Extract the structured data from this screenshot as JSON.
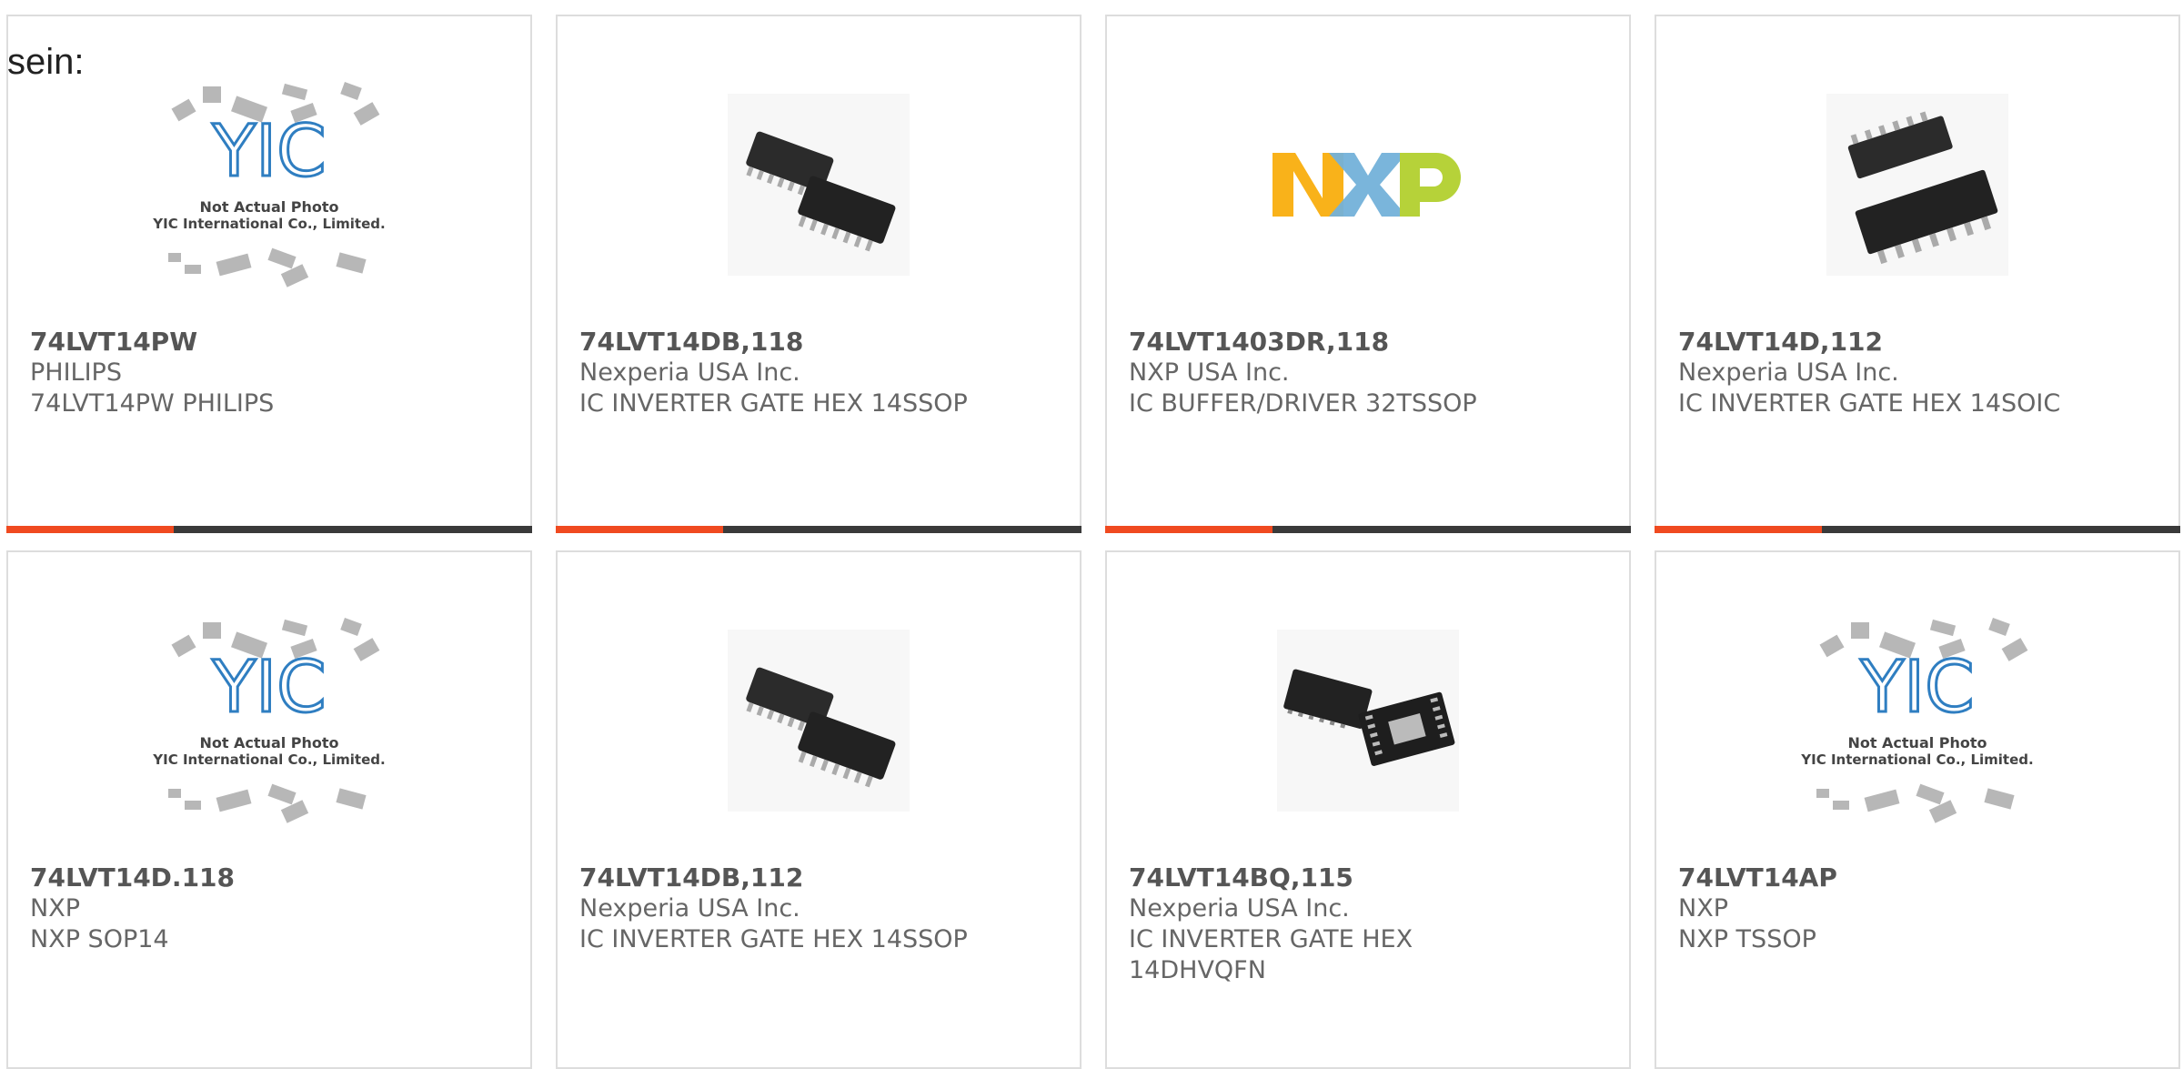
{
  "header": {
    "prefix_text": "sein:"
  },
  "products": [
    {
      "part": "74LVT14PW",
      "manufacturer": "PHILIPS",
      "description": "74LVT14PW PHILIPS",
      "image": "yic-placeholder"
    },
    {
      "part": "74LVT14DB,118",
      "manufacturer": "Nexperia USA Inc.",
      "description": "IC INVERTER GATE HEX 14SSOP",
      "image": "ssop-chip"
    },
    {
      "part": "74LVT1403DR,118",
      "manufacturer": "NXP USA Inc.",
      "description": "IC BUFFER/DRIVER 32TSSOP",
      "image": "nxp-logo"
    },
    {
      "part": "74LVT14D,112",
      "manufacturer": "Nexperia USA Inc.",
      "description": "IC INVERTER GATE HEX 14SOIC",
      "image": "soic-chip"
    },
    {
      "part": "74LVT14D.118",
      "manufacturer": "NXP",
      "description": "NXP SOP14",
      "image": "yic-placeholder"
    },
    {
      "part": "74LVT14DB,112",
      "manufacturer": "Nexperia USA Inc.",
      "description": "IC INVERTER GATE HEX 14SSOP",
      "image": "ssop-chip"
    },
    {
      "part": "74LVT14BQ,115",
      "manufacturer": "Nexperia USA Inc.",
      "description": "IC INVERTER GATE HEX 14DHVQFN",
      "image": "qfn-chip"
    },
    {
      "part": "74LVT14AP",
      "manufacturer": "NXP",
      "description": "NXP TSSOP",
      "image": "yic-placeholder"
    }
  ],
  "placeholder": {
    "line1": "Not Actual Photo",
    "line2": "YIC International Co., Limited."
  },
  "colors": {
    "accent": "#f04a20",
    "bar": "#3a3a3a",
    "nxp_orange": "#f9b21a",
    "nxp_blue": "#73b1d9",
    "nxp_green": "#b6d239"
  }
}
